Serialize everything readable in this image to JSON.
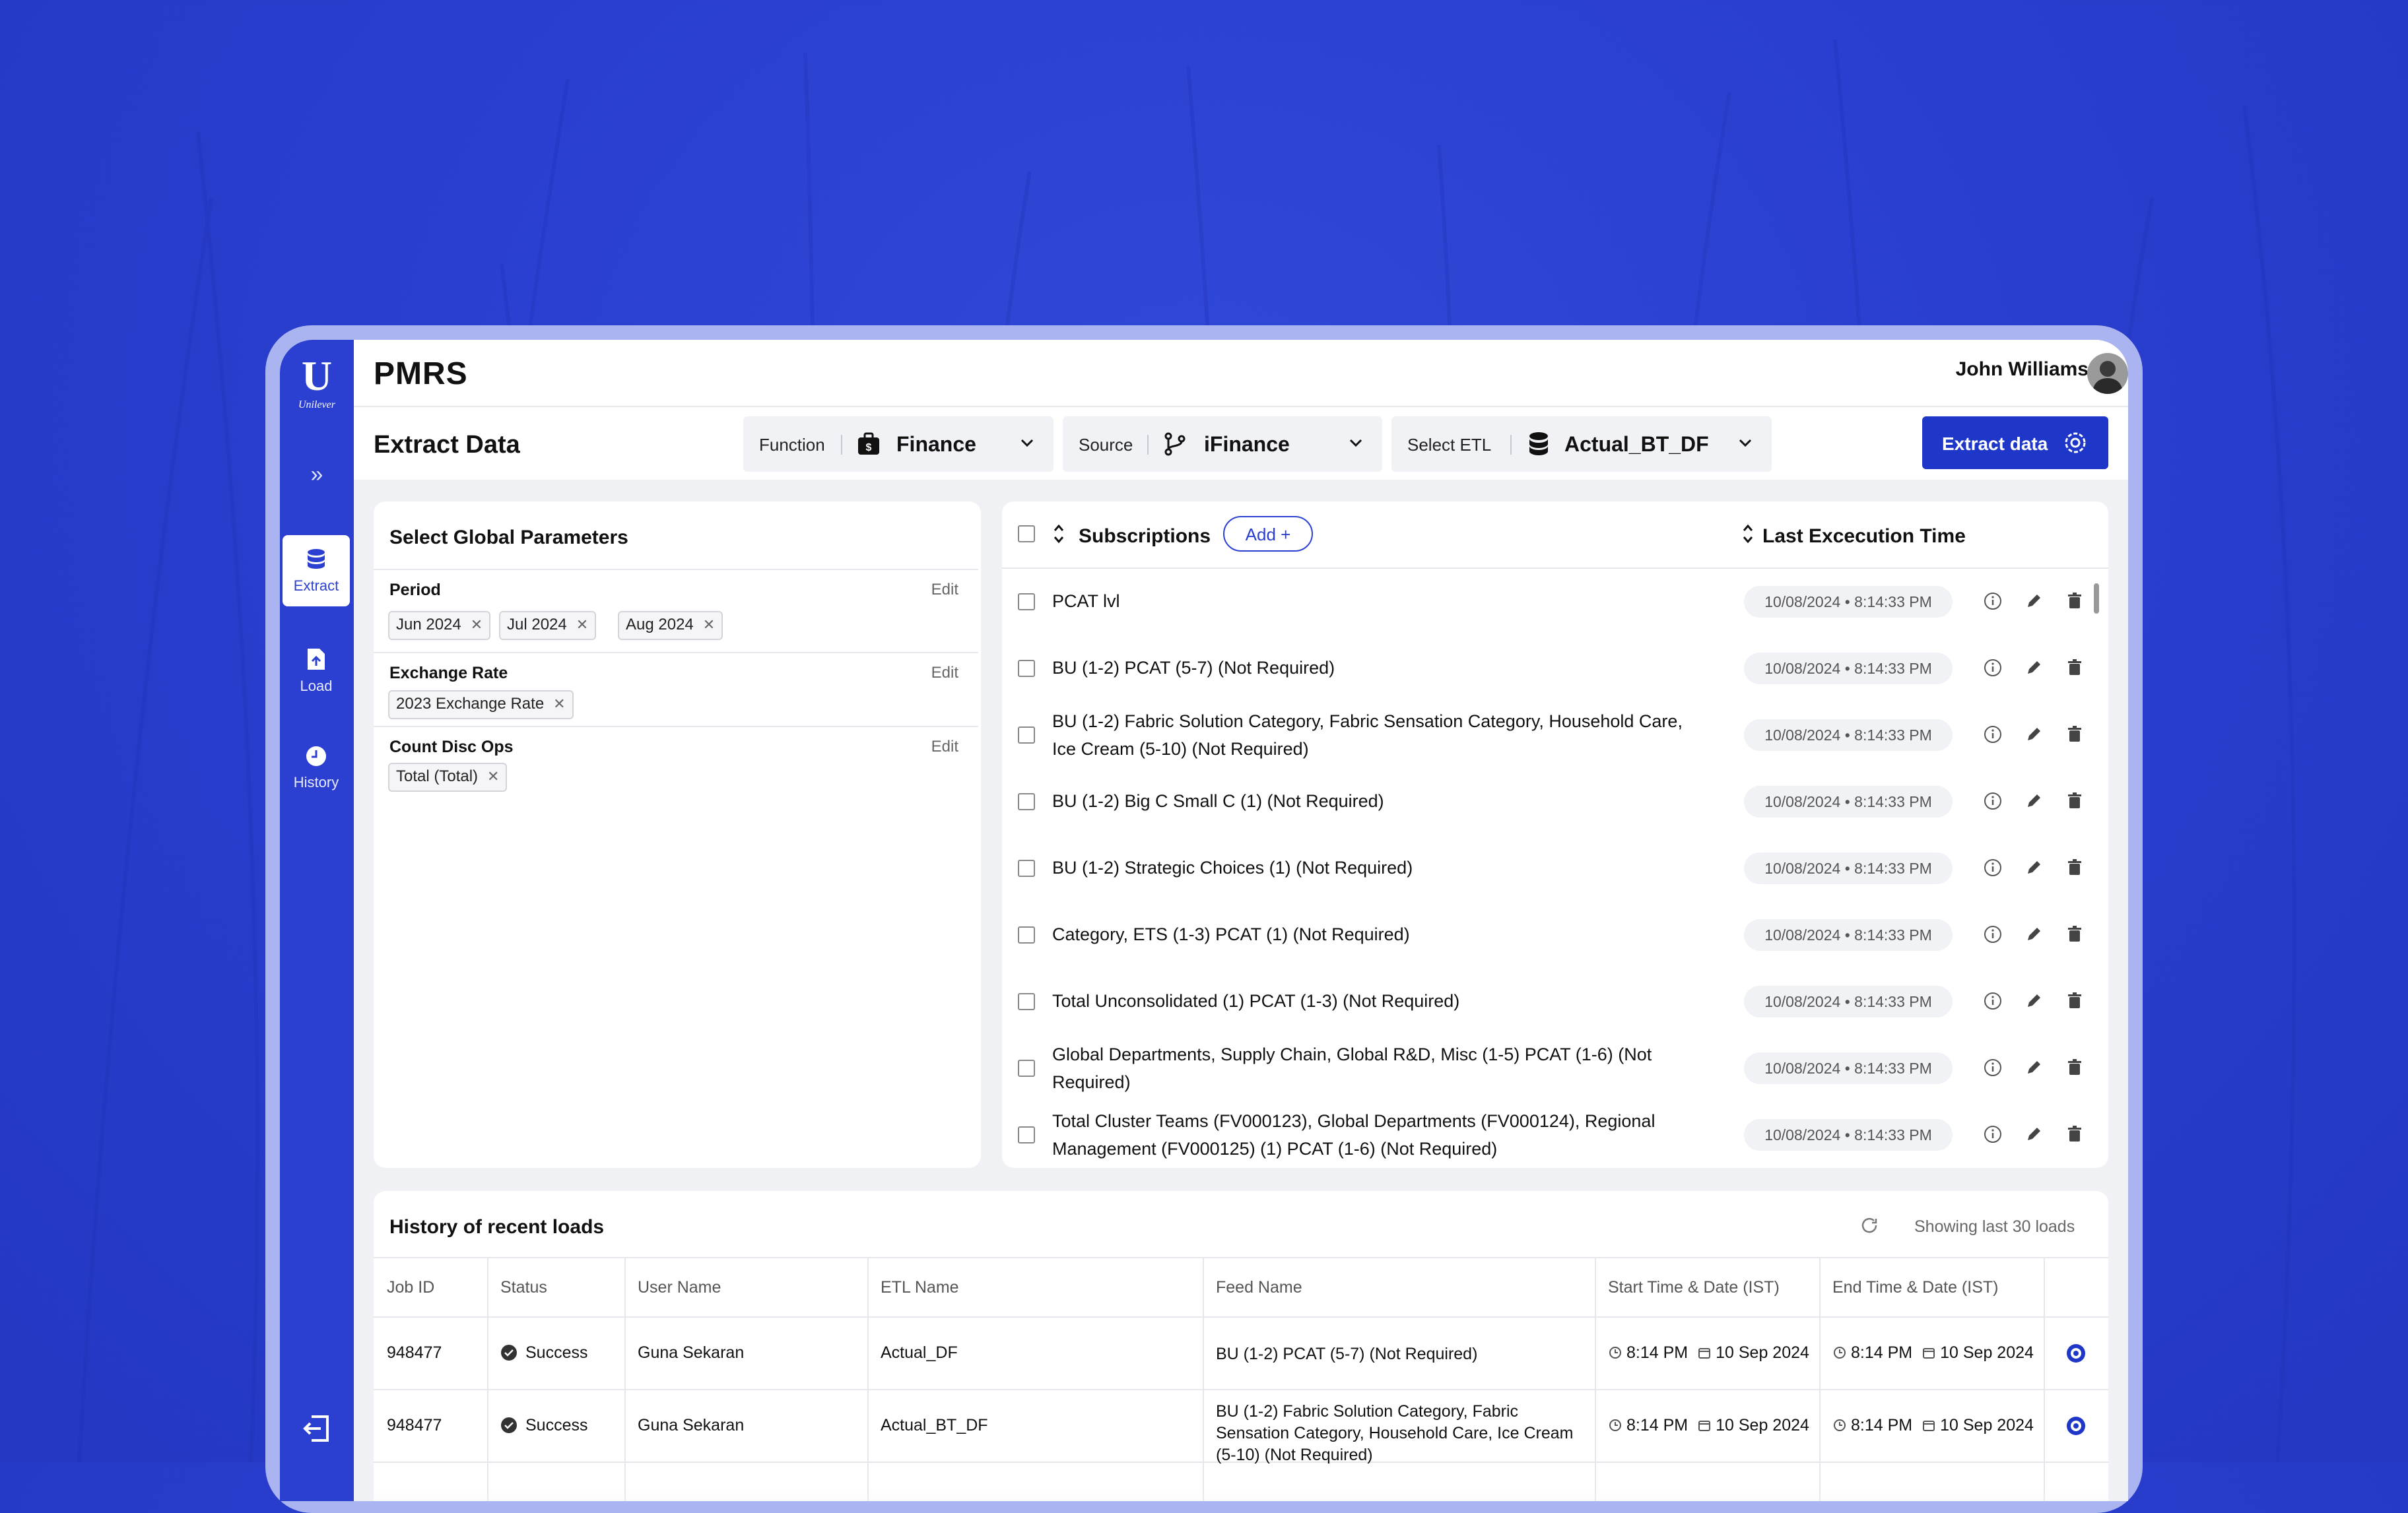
{
  "app": {
    "title": "PMRS",
    "brand": "Unilever",
    "user_name": "John Williams"
  },
  "sidebar": {
    "items": [
      {
        "label": "Extract",
        "icon": "database-icon",
        "active": true
      },
      {
        "label": "Load",
        "icon": "upload-file-icon",
        "active": false
      },
      {
        "label": "History",
        "icon": "clock-icon",
        "active": false
      }
    ]
  },
  "toolbar": {
    "page_title": "Extract Data",
    "function": {
      "label": "Function",
      "value": "Finance"
    },
    "source": {
      "label": "Source",
      "value": "iFinance"
    },
    "etl": {
      "label": "Select ETL",
      "value": "Actual_BT_DF"
    },
    "extract_button": "Extract data"
  },
  "global_params": {
    "title": "Select Global Parameters",
    "edit_label": "Edit",
    "period": {
      "label": "Period",
      "chips": [
        "Jun 2024",
        "Jul 2024",
        "Aug 2024"
      ]
    },
    "exchange_rate": {
      "label": "Exchange Rate",
      "chips": [
        "2023 Exchange Rate"
      ]
    },
    "count_disc_ops": {
      "label": "Count Disc Ops",
      "chips": [
        "Total (Total)"
      ]
    }
  },
  "subscriptions": {
    "header": "Subscriptions",
    "add_label": "Add",
    "time_header": "Last Excecution Time",
    "rows": [
      {
        "name": "PCAT lvl",
        "date": "10/08/2024",
        "time": "8:14:33 PM"
      },
      {
        "name": "BU (1-2) PCAT (5-7) (Not Required)",
        "date": "10/08/2024",
        "time": "8:14:33 PM"
      },
      {
        "name": "BU (1-2) Fabric Solution Category, Fabric Sensation Category, Household Care, Ice Cream (5-10) (Not Required)",
        "date": "10/08/2024",
        "time": "8:14:33 PM"
      },
      {
        "name": "BU (1-2) Big C Small C (1) (Not Required)",
        "date": "10/08/2024",
        "time": "8:14:33 PM"
      },
      {
        "name": "BU (1-2) Strategic Choices (1) (Not Required)",
        "date": "10/08/2024",
        "time": "8:14:33 PM"
      },
      {
        "name": "Category, ETS (1-3) PCAT (1) (Not Required)",
        "date": "10/08/2024",
        "time": "8:14:33 PM"
      },
      {
        "name": "Total Unconsolidated (1) PCAT (1-3) (Not Required)",
        "date": "10/08/2024",
        "time": "8:14:33 PM"
      },
      {
        "name": "Global Departments, Supply Chain, Global R&D, Misc (1-5) PCAT (1-6) (Not Required)",
        "date": "10/08/2024",
        "time": "8:14:33 PM"
      },
      {
        "name": "Total Cluster Teams (FV000123), Global Departments (FV000124), Regional Management (FV000125) (1) PCAT (1-6) (Not Required)",
        "date": "10/08/2024",
        "time": "8:14:33 PM"
      }
    ]
  },
  "history": {
    "title": "History of recent loads",
    "showing": "Showing last 30 loads",
    "columns": [
      "Job ID",
      "Status",
      "User Name",
      "ETL Name",
      "Feed Name",
      "Start Time & Date (IST)",
      "End Time & Date (IST)"
    ],
    "rows": [
      {
        "job_id": "948477",
        "status": "Success",
        "user": "Guna Sekaran",
        "etl": "Actual_DF",
        "feed": "BU (1-2) PCAT (5-7) (Not Required)",
        "start_time": "8:14 PM",
        "start_date": "10 Sep 2024",
        "end_time": "8:14 PM",
        "end_date": "10 Sep 2024"
      },
      {
        "job_id": "948477",
        "status": "Success",
        "user": "Guna Sekaran",
        "etl": "Actual_BT_DF",
        "feed": "BU (1-2) Fabric Solution Category, Fabric Sensation Category, Household Care, Ice Cream (5-10) (Not Required)",
        "start_time": "8:14 PM",
        "start_date": "10 Sep 2024",
        "end_time": "8:14 PM",
        "end_date": "10 Sep 2024"
      }
    ]
  },
  "colors": {
    "accent": "#2b3fd1",
    "background": "#2a3fcf",
    "button": "#1e37c8"
  }
}
